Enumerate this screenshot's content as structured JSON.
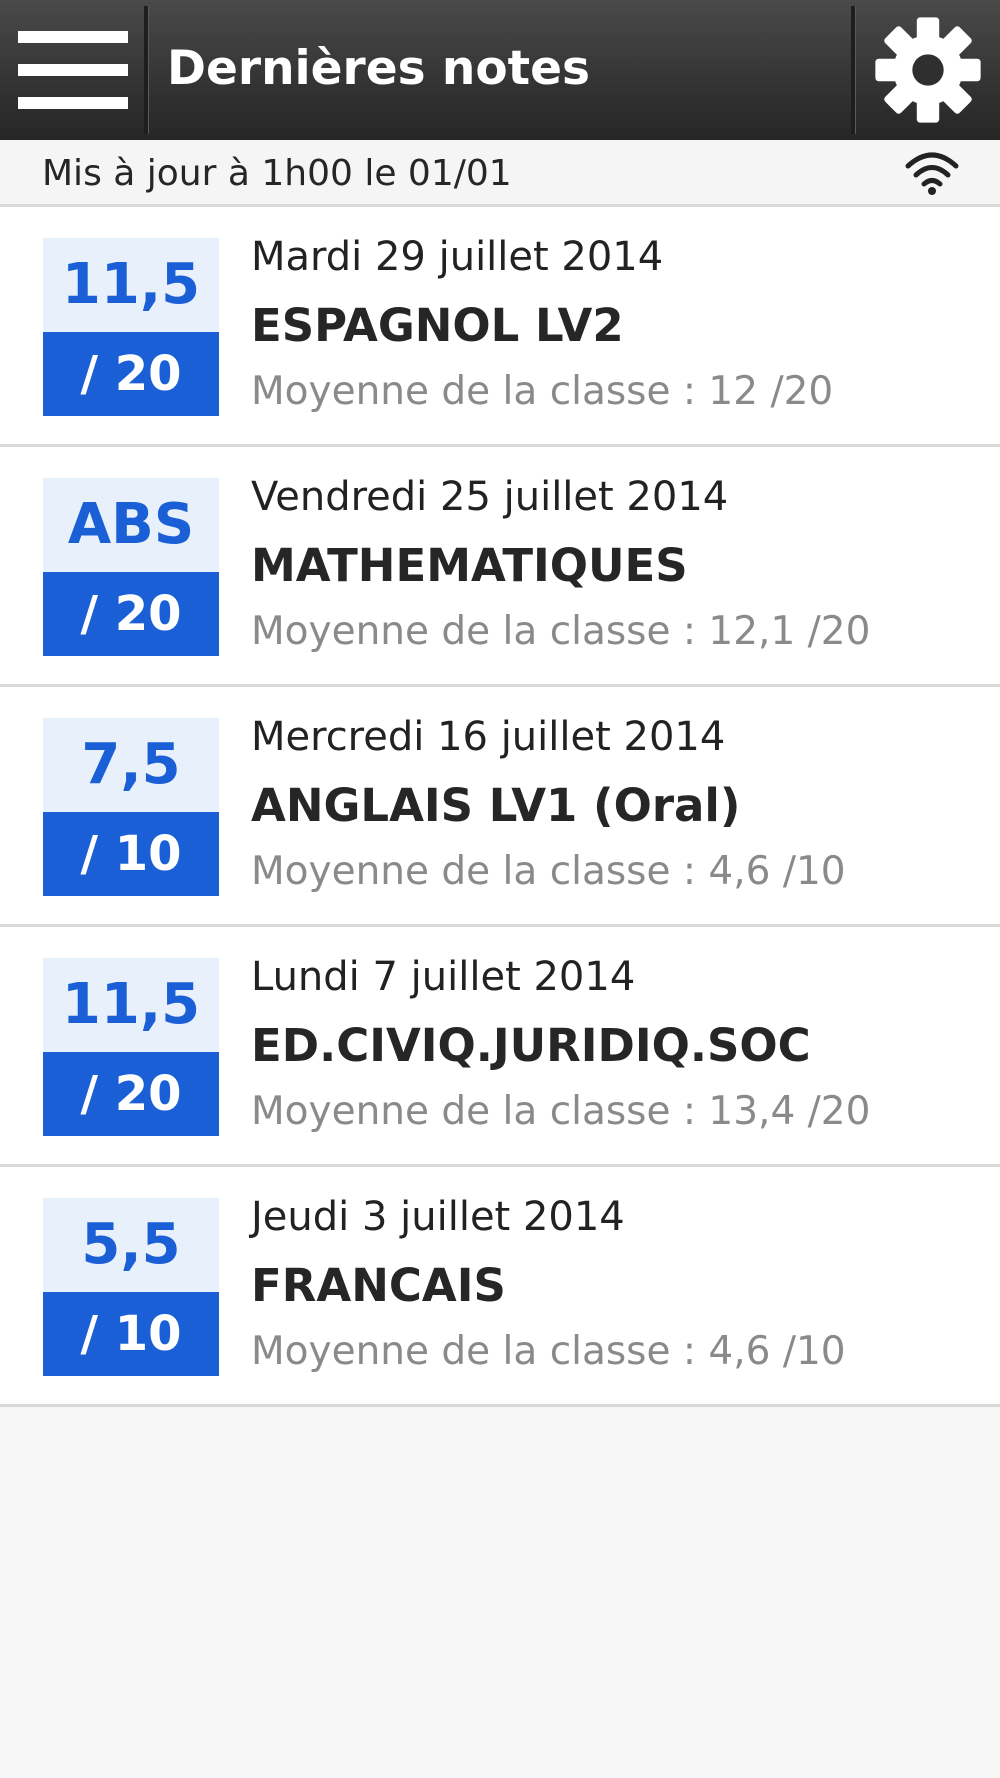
{
  "header": {
    "title": "Dernières notes",
    "menu_icon": "hamburger-menu-icon",
    "settings_icon": "gear-icon"
  },
  "status": {
    "text": "Mis à jour à 1h00 le 01/01",
    "icon": "wifi-icon"
  },
  "grades": [
    {
      "value": "11,5",
      "max": "/ 20",
      "date": "Mardi 29 juillet 2014",
      "subject": "ESPAGNOL LV2",
      "average": "Moyenne de la classe : 12 /20"
    },
    {
      "value": "ABS",
      "max": "/ 20",
      "date": "Vendredi 25 juillet 2014",
      "subject": "MATHEMATIQUES",
      "average": "Moyenne de la classe : 12,1 /20"
    },
    {
      "value": "7,5",
      "max": "/ 10",
      "date": "Mercredi 16 juillet 2014",
      "subject": "ANGLAIS LV1 (Oral)",
      "average": "Moyenne de la classe : 4,6 /10"
    },
    {
      "value": "11,5",
      "max": "/ 20",
      "date": "Lundi 7 juillet 2014",
      "subject": "ED.CIVIQ.JURIDIQ.SOC",
      "average": "Moyenne de la classe : 13,4 /20"
    },
    {
      "value": "5,5",
      "max": "/ 10",
      "date": "Jeudi 3 juillet 2014",
      "subject": "FRANCAIS",
      "average": "Moyenne de la classe : 4,6 /10"
    }
  ],
  "colors": {
    "accent": "#1a5fd6",
    "grade_bg": "#e8f0fb",
    "appbar": "#353535",
    "page_bg": "#f7f7f7"
  }
}
